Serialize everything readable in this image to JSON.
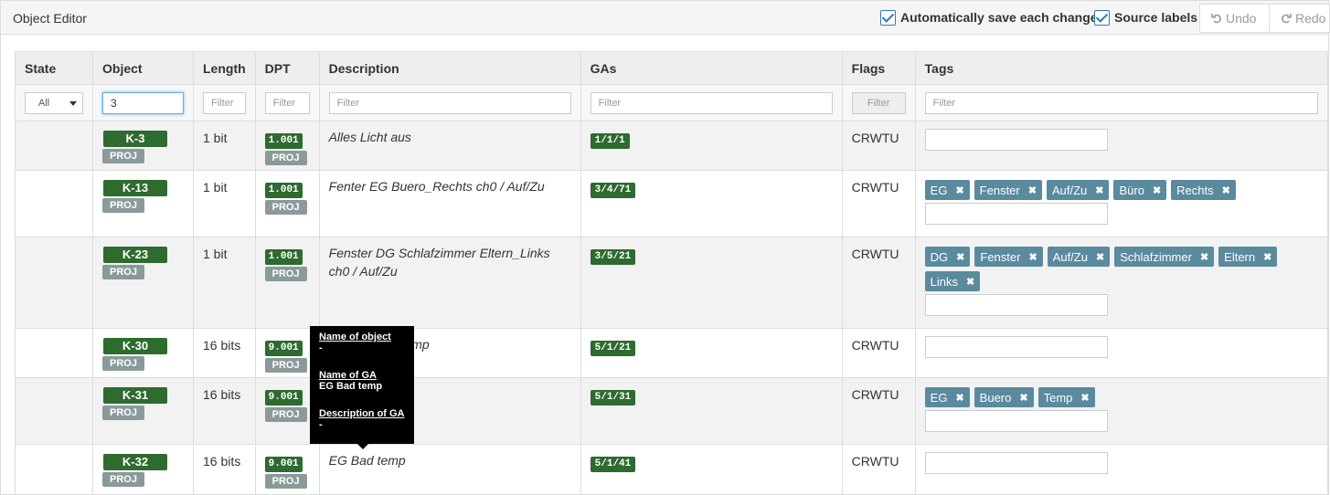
{
  "header": {
    "title": "Object Editor",
    "autosave_label": "Automatically save each change",
    "source_labels_label": "Source labels",
    "undo_label": "Undo",
    "redo_label": "Redo"
  },
  "columns": [
    "State",
    "Object",
    "Length",
    "DPT",
    "Description",
    "GAs",
    "Flags",
    "Tags"
  ],
  "filters": {
    "state_value": "All",
    "object_value": "3",
    "length_placeholder": "Filter",
    "dpt_placeholder": "Filter",
    "description_placeholder": "Filter",
    "gas_placeholder": "Filter",
    "flags_placeholder": "Filter",
    "tags_placeholder": "Filter"
  },
  "rows": [
    {
      "object": "K-3",
      "badge": "PROJ",
      "length": "1 bit",
      "dpt": "1.001",
      "dpt_badge": "PROJ",
      "description": "Alles Licht aus",
      "ga": "1/1/1",
      "flags": "CRWTU",
      "tags": []
    },
    {
      "object": "K-13",
      "badge": "PROJ",
      "length": "1 bit",
      "dpt": "1.001",
      "dpt_badge": "PROJ",
      "description": "Fenter EG Buero_Rechts ch0 / Auf/Zu",
      "ga": "3/4/71",
      "flags": "CRWTU",
      "tags": [
        "EG",
        "Fenster",
        "Auf/Zu",
        "Büro",
        "Rechts"
      ]
    },
    {
      "object": "K-23",
      "badge": "PROJ",
      "length": "1 bit",
      "dpt": "1.001",
      "dpt_badge": "PROJ",
      "description": "Fenster DG Schlafzimmer Eltern_Links ch0 / Auf/Zu",
      "ga": "3/5/21",
      "flags": "CRWTU",
      "tags": [
        "DG",
        "Fenster",
        "Auf/Zu",
        "Schlafzimmer",
        "Eltern",
        "Links"
      ]
    },
    {
      "object": "K-30",
      "badge": "PROJ",
      "length": "16 bits",
      "dpt": "9.001",
      "dpt_badge": "PROJ",
      "description": "EG Kueche Temp",
      "ga": "5/1/21",
      "flags": "CRWTU",
      "tags": []
    },
    {
      "object": "K-31",
      "badge": "PROJ",
      "length": "16 bits",
      "dpt": "9.001",
      "dpt_badge": "PROJ",
      "description": "EG Bad Temp",
      "ga": "5/1/31",
      "flags": "CRWTU",
      "tags": [
        "EG",
        "Buero",
        "Temp"
      ]
    },
    {
      "object": "K-32",
      "badge": "PROJ",
      "length": "16 bits",
      "dpt": "9.001",
      "dpt_badge": "PROJ",
      "description": "EG Bad temp",
      "ga": "5/1/41",
      "flags": "CRWTU",
      "tags": []
    }
  ],
  "tooltip": {
    "name_of_object_label": "Name of object",
    "name_of_object_value": "-",
    "name_of_ga_label": "Name of GA",
    "name_of_ga_value": "EG Bad temp",
    "description_of_ga_label": "Description of GA",
    "description_of_ga_value": "-"
  },
  "colors": {
    "object_badge": "#2d6b2f",
    "proj_badge": "#8a9a9a",
    "tag": "#5a8a9e",
    "checkbox": "#2f7ab8"
  }
}
